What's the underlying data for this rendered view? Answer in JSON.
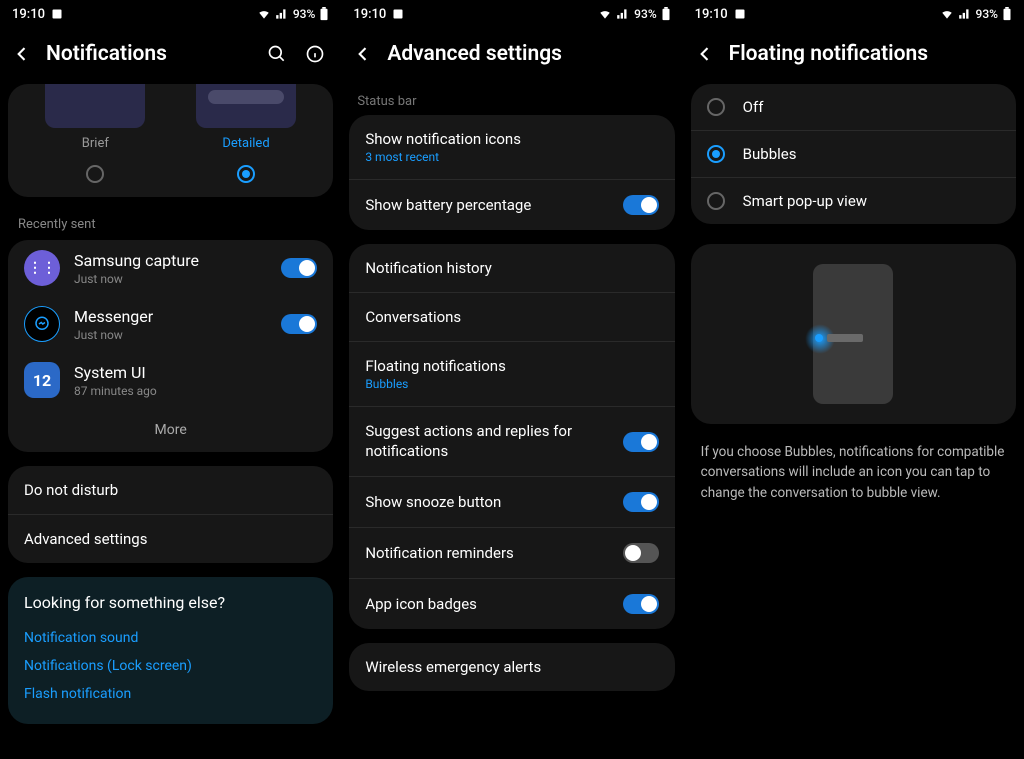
{
  "status": {
    "time": "19:10",
    "battery": "93%"
  },
  "screen1": {
    "title": "Notifications",
    "style_brief": "Brief",
    "style_detailed": "Detailed",
    "recently_sent": "Recently sent",
    "apps": [
      {
        "name": "Samsung capture",
        "sub": "Just now"
      },
      {
        "name": "Messenger",
        "sub": "Just now"
      },
      {
        "name": "System UI",
        "sub": "87 minutes ago"
      }
    ],
    "more": "More",
    "dnd": "Do not disturb",
    "advanced": "Advanced settings",
    "looking_title": "Looking for something else?",
    "links": [
      "Notification sound",
      "Notifications (Lock screen)",
      "Flash notification"
    ]
  },
  "screen2": {
    "title": "Advanced settings",
    "status_bar_label": "Status bar",
    "show_icons": "Show notification icons",
    "show_icons_sub": "3 most recent",
    "show_battery": "Show battery percentage",
    "items": {
      "history": "Notification history",
      "conversations": "Conversations",
      "floating": "Floating notifications",
      "floating_sub": "Bubbles",
      "suggest": "Suggest actions and replies for notifications",
      "snooze": "Show snooze button",
      "reminders": "Notification reminders",
      "badges": "App icon badges"
    },
    "wireless": "Wireless emergency alerts"
  },
  "screen3": {
    "title": "Floating notifications",
    "options": {
      "off": "Off",
      "bubbles": "Bubbles",
      "smart": "Smart pop-up view"
    },
    "desc": "If you choose Bubbles, notifications for compatible conversations will include an icon you can tap to change the conversation to bubble view."
  }
}
